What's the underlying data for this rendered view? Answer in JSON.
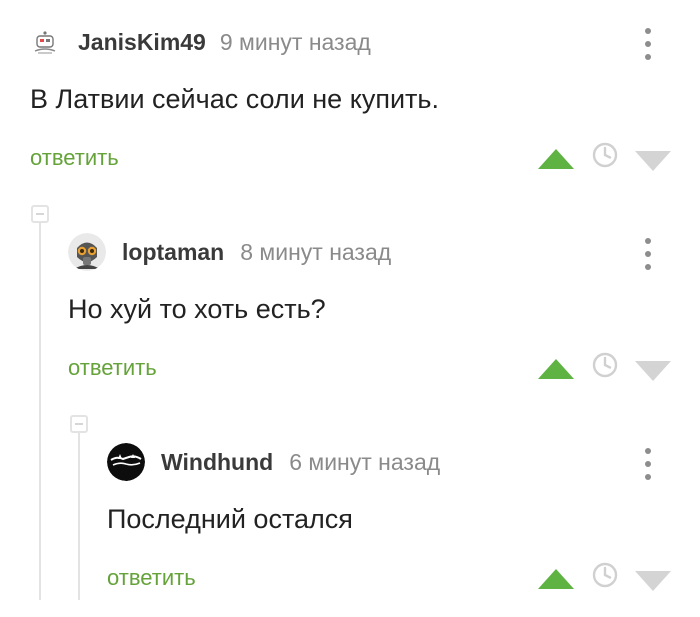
{
  "comments": [
    {
      "username": "JanisKim49",
      "time": "9 минут назад",
      "text": "В Латвии сейчас соли не купить.",
      "reply_label": "ответить",
      "avatar_icon": "robot-avatar-icon"
    },
    {
      "username": "loptaman",
      "time": "8 минут назад",
      "text": "Но хуй то хоть есть?",
      "reply_label": "ответить",
      "avatar_icon": "gasmask-avatar-icon"
    },
    {
      "username": "Windhund",
      "time": "6 минут назад",
      "text": "Последний остался",
      "reply_label": "ответить",
      "avatar_icon": "black-wolf-avatar-icon"
    }
  ],
  "colors": {
    "accent_green": "#65a33a",
    "vote_up": "#5fb342",
    "vote_down": "#d4d4d4",
    "muted_text": "#8a8a8a",
    "thread_line": "#e3e3e3"
  }
}
